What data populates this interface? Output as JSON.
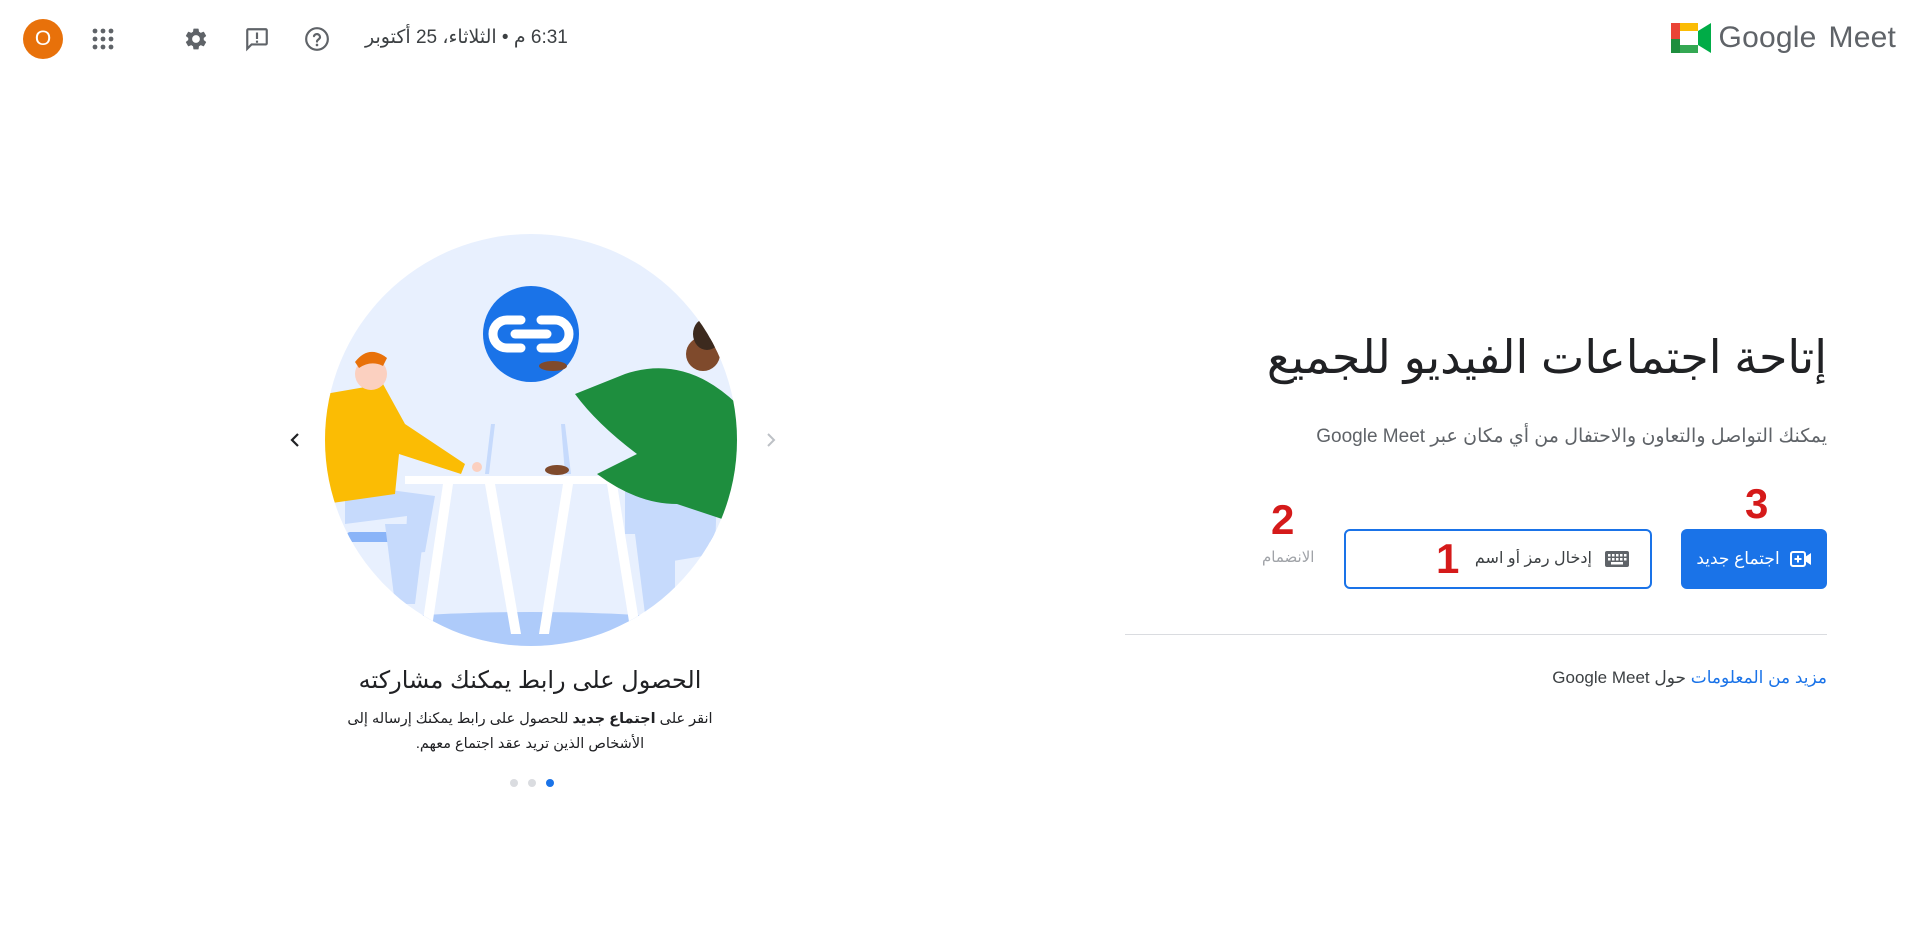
{
  "header": {
    "product_name": "Meet",
    "brand_name": "Google",
    "datetime": "6:31 م • الثلاثاء، 25 أكتوبر",
    "avatar_letter": "O",
    "icons": [
      "apps-grid-icon",
      "settings-gear-icon",
      "feedback-icon",
      "help-icon"
    ]
  },
  "hero": {
    "title": "إتاحة اجتماعات الفيديو للجميع",
    "subtitle": "يمكنك التواصل والتعاون والاحتفال من أي مكان عبر Google Meet",
    "new_meeting_label": "اجتماع جديد",
    "code_placeholder": "إدخال رمز أو اسم",
    "join_label": "الانضمام",
    "learn_more_link": "مزيد من المعلومات",
    "learn_more_rest": "حول Google Meet"
  },
  "markers": {
    "one": "1",
    "two": "2",
    "three": "3"
  },
  "carousel": {
    "slide_title": "الحصول على رابط يمكنك مشاركته",
    "desc_prefix": "انقر على",
    "desc_bold": "اجتماع جديد",
    "desc_suffix": "للحصول على رابط يمكنك إرساله إلى الأشخاص الذين تريد عقد اجتماع معهم.",
    "dots_total": 3,
    "active_dot": 3
  },
  "colors": {
    "accent": "#1a73e8",
    "avatar": "#e8710a",
    "marker_red": "#d51a1a"
  }
}
